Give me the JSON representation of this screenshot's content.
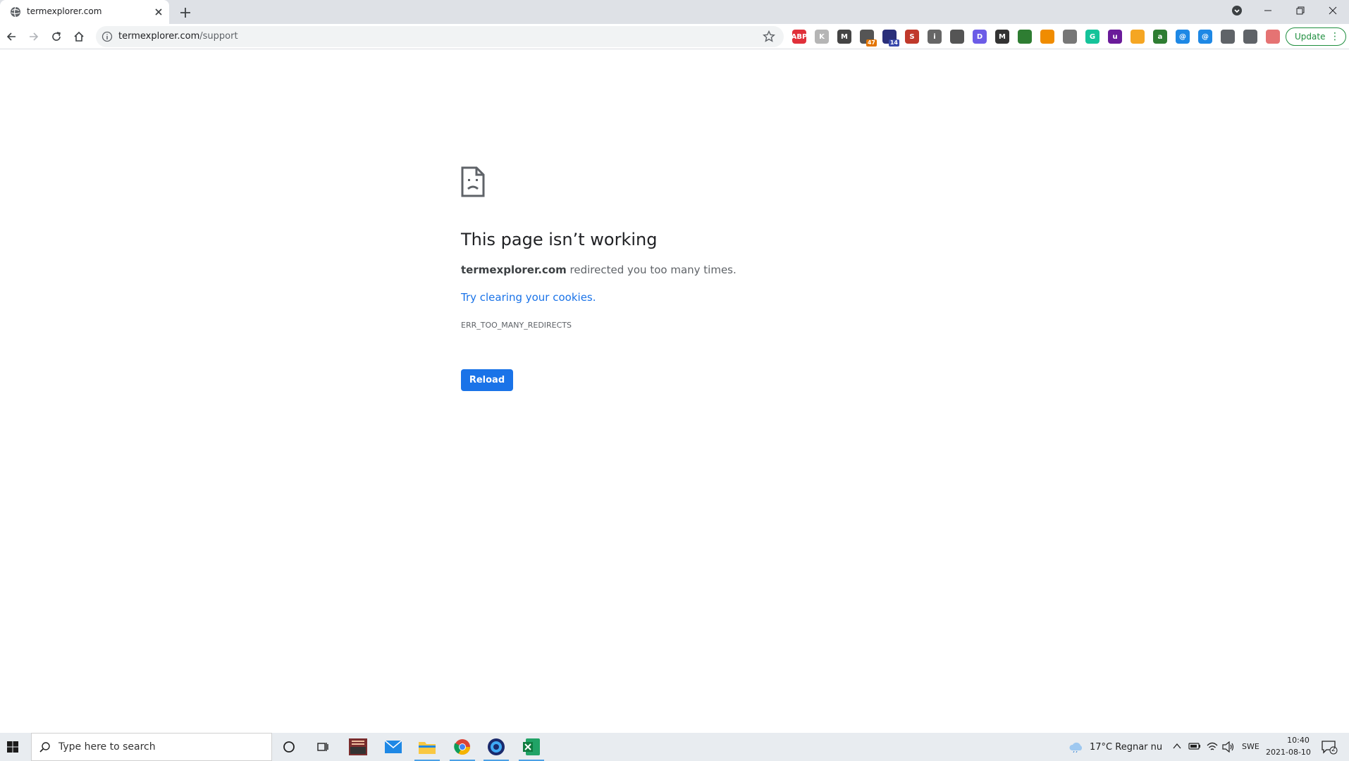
{
  "browser": {
    "tab_title": "termexplorer.com",
    "url_domain": "termexplorer.com",
    "url_path": "/support",
    "update_label": "Update",
    "extensions": [
      {
        "name": "adblock-plus-icon",
        "label": "ABP",
        "color": "#e0303a"
      },
      {
        "name": "k-extension-icon",
        "label": "K",
        "color": "#b5b5b5"
      },
      {
        "name": "m-extension-icon",
        "label": "M",
        "color": "#444444"
      },
      {
        "name": "python-extension-icon",
        "label": "",
        "color": "#555555",
        "badge": "47",
        "badge_color": "#e37400"
      },
      {
        "name": "mortarboard-extension-icon",
        "label": "",
        "color": "#2a2f7a",
        "badge": "14",
        "badge_color": "#3949ab"
      },
      {
        "name": "s-extension-icon",
        "label": "S",
        "color": "#c0392b"
      },
      {
        "name": "i-extension-icon",
        "label": "i",
        "color": "#666666"
      },
      {
        "name": "scan-extension-icon",
        "label": "",
        "color": "#555555"
      },
      {
        "name": "d-extension-icon",
        "label": "D",
        "color": "#6c5ce7"
      },
      {
        "name": "bracket-m-extension-icon",
        "label": "M",
        "color": "#333333"
      },
      {
        "name": "pin-extension-icon",
        "label": "",
        "color": "#2e7d32"
      },
      {
        "name": "fox-extension-icon",
        "label": "",
        "color": "#f08c00"
      },
      {
        "name": "gear-extension-icon",
        "label": "",
        "color": "#777777"
      },
      {
        "name": "grammarly-icon",
        "label": "G",
        "color": "#15c39a"
      },
      {
        "name": "u-extension-icon",
        "label": "u",
        "color": "#6a1b9a"
      },
      {
        "name": "half-circle-extension-icon",
        "label": "",
        "color": "#f5a623"
      },
      {
        "name": "a-extension-icon",
        "label": "a",
        "color": "#2e7d32"
      },
      {
        "name": "at-extension-icon-1",
        "label": "@",
        "color": "#1e88e5"
      },
      {
        "name": "at-extension-icon-2",
        "label": "@",
        "color": "#1e88e5"
      },
      {
        "name": "puzzle-extensions-icon",
        "label": "",
        "color": "#5f6368"
      },
      {
        "name": "reading-list-icon",
        "label": "",
        "color": "#5f6368"
      },
      {
        "name": "profile-avatar-icon",
        "label": "",
        "color": "#e57373"
      }
    ]
  },
  "error": {
    "title": "This page isn’t working",
    "desc_domain": "termexplorer.com",
    "desc_rest": " redirected you too many times.",
    "suggestion": "Try clearing your cookies.",
    "code": "ERR_TOO_MANY_REDIRECTS",
    "reload_label": "Reload"
  },
  "taskbar": {
    "search_placeholder": "Type here to search",
    "weather": "17°C  Regnar nu",
    "language": "SWE",
    "time": "10:40",
    "date": "2021-08-10",
    "notification_count": "2"
  }
}
